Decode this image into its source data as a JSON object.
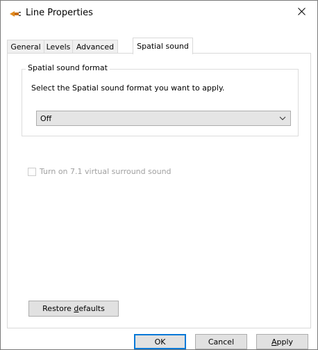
{
  "window": {
    "title": "Line Properties",
    "title_icon": "speaker-plug-icon",
    "close_icon": "close-icon"
  },
  "tabs": [
    {
      "label": "General",
      "active": false
    },
    {
      "label": "Levels",
      "active": false
    },
    {
      "label": "Advanced",
      "active": false
    },
    {
      "label": "Spatial sound",
      "active": true
    }
  ],
  "spatial": {
    "group_label": "Spatial sound format",
    "description": "Select the Spatial sound format you want to apply.",
    "format_selected": "Off",
    "dropdown_icon": "chevron-down-icon"
  },
  "virtual_surround": {
    "label": "Turn on 7.1 virtual surround sound",
    "checked": false,
    "enabled": false
  },
  "buttons": {
    "restore_pre": "Restore ",
    "restore_key": "d",
    "restore_post": "efaults",
    "ok": "OK",
    "cancel": "Cancel",
    "apply_key": "A",
    "apply_post": "pply"
  }
}
